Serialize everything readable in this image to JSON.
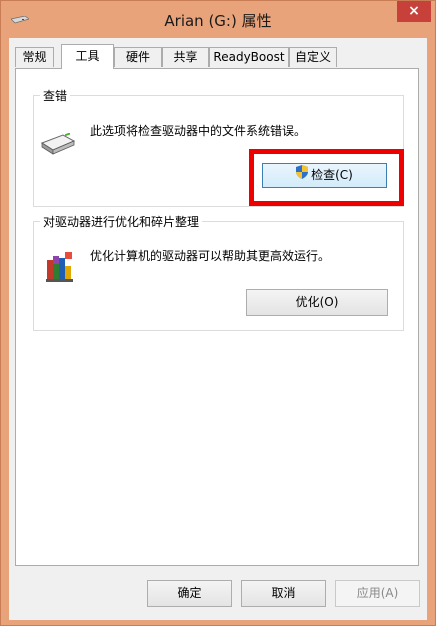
{
  "window": {
    "title": "Arian (G:) 属性",
    "close_label": "×"
  },
  "tabs": [
    {
      "label": "常规"
    },
    {
      "label": "工具"
    },
    {
      "label": "硬件"
    },
    {
      "label": "共享"
    },
    {
      "label": "ReadyBoost"
    },
    {
      "label": "自定义"
    }
  ],
  "active_tab": "工具",
  "check_group": {
    "title": "查错",
    "description": "此选项将检查驱动器中的文件系统错误。",
    "button_label": "检查(C)",
    "icon": "drive-icon",
    "button_icon": "uac-shield-icon"
  },
  "optimize_group": {
    "title": "对驱动器进行优化和碎片整理",
    "description": "优化计算机的驱动器可以帮助其更高效运行。",
    "button_label": "优化(O)",
    "icon": "defrag-icon"
  },
  "footer": {
    "ok_label": "确定",
    "cancel_label": "取消",
    "apply_label": "应用(A)"
  },
  "colors": {
    "frame": "#e9a37a",
    "close": "#c7413a",
    "highlight": "#ee0000"
  }
}
